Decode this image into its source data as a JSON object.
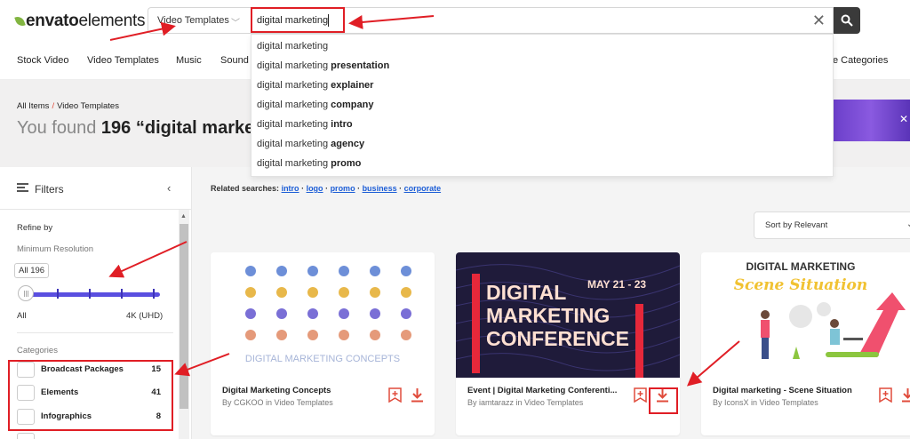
{
  "header": {
    "logo_bold": "envato",
    "logo_light": "elements",
    "category_select": "Video Templates",
    "search_value": "digital marketing"
  },
  "nav": {
    "items": [
      "Stock Video",
      "Video Templates",
      "Music",
      "Sound",
      "e Categories"
    ]
  },
  "suggestions": [
    {
      "base": "digital marketing",
      "bold": ""
    },
    {
      "base": "digital marketing ",
      "bold": "presentation"
    },
    {
      "base": "digital marketing ",
      "bold": "explainer"
    },
    {
      "base": "digital marketing ",
      "bold": "company"
    },
    {
      "base": "digital marketing ",
      "bold": "intro"
    },
    {
      "base": "digital marketing ",
      "bold": "agency"
    },
    {
      "base": "digital marketing ",
      "bold": "promo"
    }
  ],
  "hero": {
    "breadcrumb_root": "All Items",
    "breadcrumb_sep": "/",
    "breadcrumb_current": "Video Templates",
    "found_prefix": "You found ",
    "found_count": "196",
    "found_rest": " “digital marke"
  },
  "sidebar": {
    "filters_label": "Filters",
    "refine_label": "Refine by",
    "min_res_label": "Minimum Resolution",
    "slider_tooltip": "All 196",
    "range_min": "All",
    "range_max": "4K (UHD)",
    "categories_label": "Categories",
    "categories": [
      {
        "name": "Broadcast Packages",
        "count": "15"
      },
      {
        "name": "Elements",
        "count": "41"
      },
      {
        "name": "Infographics",
        "count": "8"
      }
    ]
  },
  "main": {
    "related_label": "Related searches:",
    "related": [
      "intro",
      "logo",
      "promo",
      "business",
      "corporate"
    ],
    "sort_label": "Sort by Relevant",
    "cards": [
      {
        "title": "Digital Marketing Concepts",
        "byline": "By CGKOO in Video Templates",
        "thumb_text": "DIGITAL MARKETING CONCEPTS"
      },
      {
        "title": "Event | Digital Marketing Conferenti...",
        "byline": "By iamtarazz in Video Templates",
        "thumb_l1": "DIGITAL",
        "thumb_l2": "MARKETING",
        "thumb_l3": "CONFERENCE",
        "thumb_date": "MAY 21 - 23"
      },
      {
        "title": "Digital marketing - Scene Situation",
        "byline": "By IconsX in Video Templates",
        "thumb_t1": "DIGITAL MARKETING",
        "thumb_t2": "Scene Situation"
      }
    ]
  },
  "colors": {
    "accent": "#82b541",
    "annotation": "#e01e25",
    "slider": "#5a4fe0",
    "download": "#e04c3c"
  }
}
